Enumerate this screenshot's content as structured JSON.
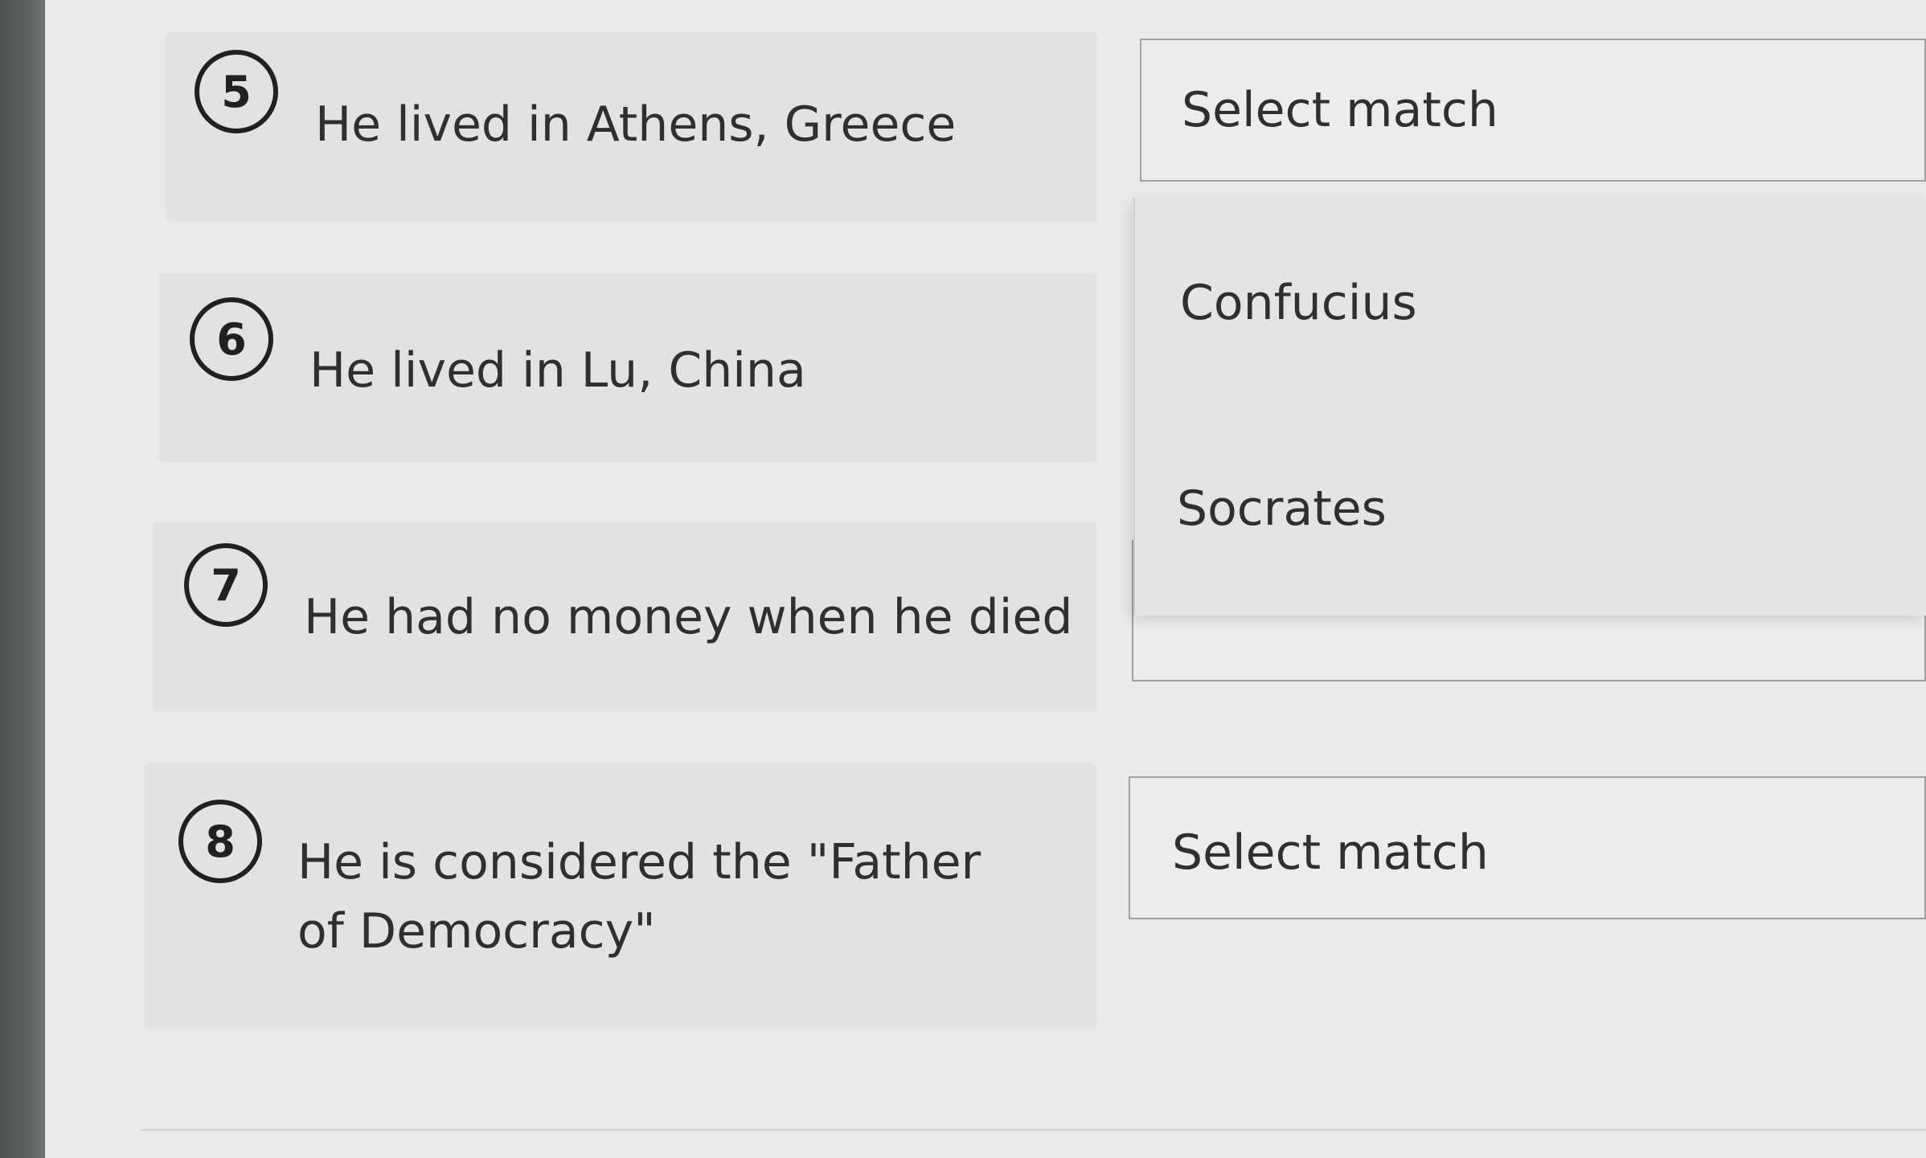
{
  "questions": [
    {
      "number": "5",
      "prompt": "He lived in Athens, Greece",
      "select_label": "Select match"
    },
    {
      "number": "6",
      "prompt": "He lived in Lu, China"
    },
    {
      "number": "7",
      "prompt": "He had no money when he died"
    },
    {
      "number": "8",
      "prompt": "He is considered the \"Father of Democracy\"",
      "select_label": "Select match"
    }
  ],
  "dropdown": {
    "options": [
      "Confucius",
      "Socrates"
    ]
  }
}
